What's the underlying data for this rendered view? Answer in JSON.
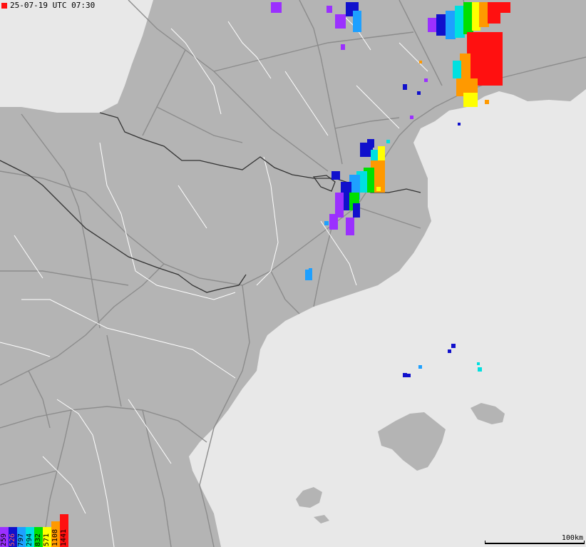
{
  "timestamp": "25-07-19 UTC 07:30",
  "legend": {
    "items": [
      {
        "label": "259",
        "color": "#9b30ff"
      },
      {
        "label": "526",
        "color": "#1010cc"
      },
      {
        "label": "797",
        "color": "#1ea0ff"
      },
      {
        "label": "294",
        "color": "#00e0e0"
      },
      {
        "label": "832",
        "color": "#00e000"
      },
      {
        "label": "571",
        "color": "#ffff00"
      },
      {
        "label": "1108",
        "color": "#ff9900"
      },
      {
        "label": "1441",
        "color": "#ff1010"
      }
    ]
  },
  "scale_label": "100km",
  "colors": {
    "sea": "#e8e8e8",
    "land": "#b4b4b4",
    "road": "#8c8c8c",
    "border_national": "#333333",
    "border_region": "#ffffff"
  }
}
